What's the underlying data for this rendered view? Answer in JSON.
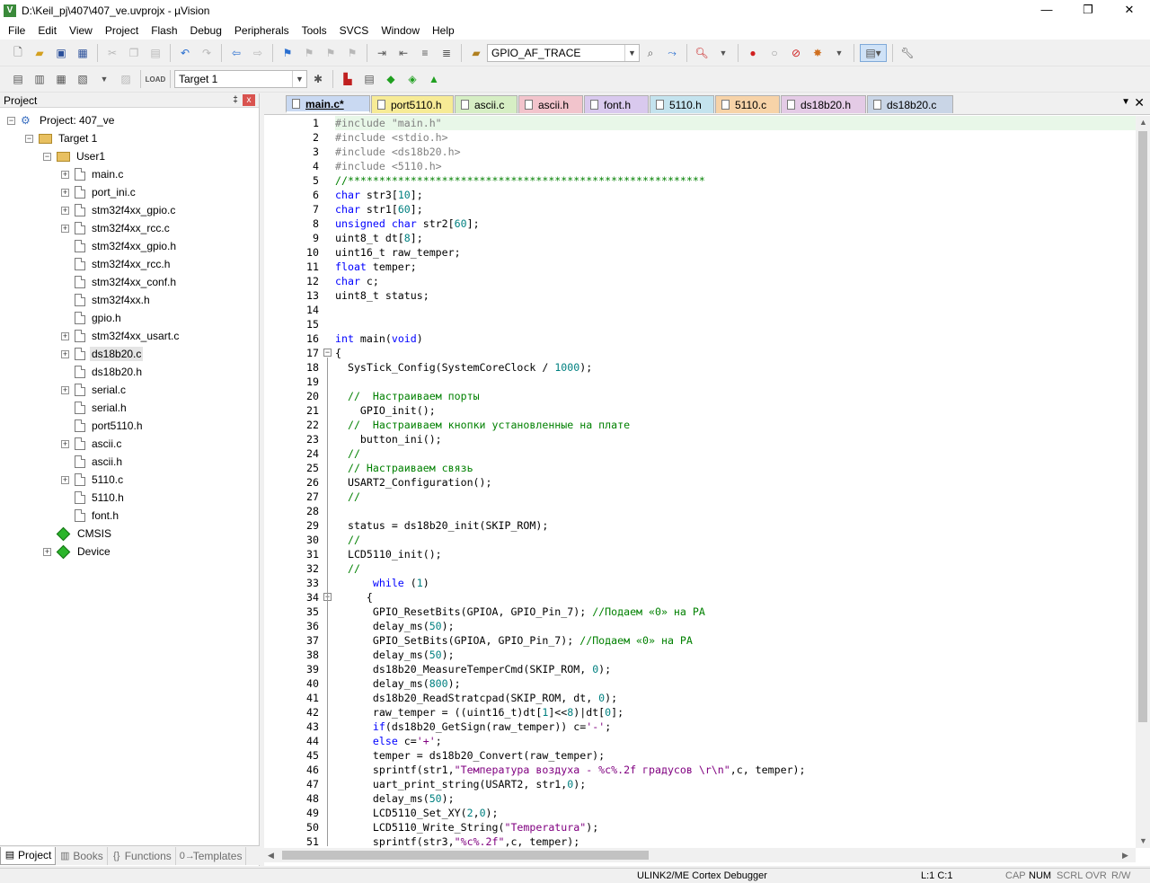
{
  "window": {
    "title": "D:\\Keil_pj\\407\\407_ve.uvprojx - µVision",
    "app_icon": "V",
    "minimize": "—",
    "maximize": "❐",
    "close": "✕"
  },
  "menu": [
    "File",
    "Edit",
    "View",
    "Project",
    "Flash",
    "Debug",
    "Peripherals",
    "Tools",
    "SVCS",
    "Window",
    "Help"
  ],
  "toolbar1": {
    "find_combo_value": "GPIO_AF_TRACE"
  },
  "toolbar2": {
    "target_combo_value": "Target 1"
  },
  "project_panel": {
    "title": "Project",
    "pin": "‡",
    "close": "x",
    "tree": {
      "project": "Project: 407_ve",
      "target": "Target 1",
      "group": "User1",
      "files": [
        {
          "name": "main.c",
          "expandable": true
        },
        {
          "name": "port_ini.c",
          "expandable": true
        },
        {
          "name": "stm32f4xx_gpio.c",
          "expandable": true
        },
        {
          "name": "stm32f4xx_rcc.c",
          "expandable": true
        },
        {
          "name": "stm32f4xx_gpio.h",
          "expandable": false
        },
        {
          "name": "stm32f4xx_rcc.h",
          "expandable": false
        },
        {
          "name": "stm32f4xx_conf.h",
          "expandable": false
        },
        {
          "name": "stm32f4xx.h",
          "expandable": false
        },
        {
          "name": "gpio.h",
          "expandable": false
        },
        {
          "name": "stm32f4xx_usart.c",
          "expandable": true
        },
        {
          "name": "ds18b20.c",
          "expandable": true
        },
        {
          "name": "ds18b20.h",
          "expandable": false
        },
        {
          "name": "serial.c",
          "expandable": true
        },
        {
          "name": "serial.h",
          "expandable": false
        },
        {
          "name": "port5110.h",
          "expandable": false
        },
        {
          "name": "ascii.c",
          "expandable": true
        },
        {
          "name": "ascii.h",
          "expandable": false
        },
        {
          "name": "5110.c",
          "expandable": true
        },
        {
          "name": "5110.h",
          "expandable": false
        },
        {
          "name": "font.h",
          "expandable": false
        }
      ],
      "cmsis": "CMSIS",
      "device": "Device"
    },
    "bottom_tabs": [
      {
        "label": "Project",
        "icon": "▤"
      },
      {
        "label": "Books",
        "icon": "▥"
      },
      {
        "label": "Functions",
        "icon": "{}"
      },
      {
        "label": "Templates",
        "icon": "0→"
      }
    ]
  },
  "editor_tabs": [
    {
      "label": "main.c*",
      "color": "#c9d9f2"
    },
    {
      "label": "port5110.h",
      "color": "#f7eb96"
    },
    {
      "label": "ascii.c",
      "color": "#d6eec4"
    },
    {
      "label": "ascii.h",
      "color": "#f2c4cc"
    },
    {
      "label": "font.h",
      "color": "#d9c9ee"
    },
    {
      "label": "5110.h",
      "color": "#c4e3ee"
    },
    {
      "label": "5110.c",
      "color": "#f7d3a8"
    },
    {
      "label": "ds18b20.h",
      "color": "#e4cbe6"
    },
    {
      "label": "ds18b20.c",
      "color": "#c9d5e6"
    }
  ],
  "code_lines": [
    "#include \"main.h\"",
    "#include <stdio.h>",
    "#include <ds18b20.h>",
    "#include <5110.h>",
    "//*********************************************************",
    "char str3[10];",
    "char str1[60];",
    "unsigned char str2[60];",
    "uint8_t dt[8];",
    "uint16_t raw_temper;",
    "float temper;",
    "char c;",
    "uint8_t status;",
    "",
    "",
    "int main(void)",
    "{",
    "  SysTick_Config(SystemCoreClock / 1000);",
    "",
    "  //  Настраиваем порты",
    "    GPIO_init();",
    "  //  Настраиваем кнопки установленные на плате",
    "    button_ini();",
    "  //",
    "  // Настраиваем связь",
    "  USART2_Configuration();",
    "  //",
    "",
    "  status = ds18b20_init(SKIP_ROM);",
    "  //",
    "  LCD5110_init();",
    "  //",
    "      while (1)",
    "     {",
    "      GPIO_ResetBits(GPIOA, GPIO_Pin_7); //Подаем «0» на PA",
    "      delay_ms(50);",
    "      GPIO_SetBits(GPIOA, GPIO_Pin_7); //Подаем «0» на PA",
    "      delay_ms(50);",
    "      ds18b20_MeasureTemperCmd(SKIP_ROM, 0);",
    "      delay_ms(800);",
    "      ds18b20_ReadStratcpad(SKIP_ROM, dt, 0);",
    "      raw_temper = ((uint16_t)dt[1]<<8)|dt[0];",
    "      if(ds18b20_GetSign(raw_temper)) c='-';",
    "      else c='+';",
    "      temper = ds18b20_Convert(raw_temper);",
    "      sprintf(str1,\"Температура воздуха - %c%.2f градусов \\r\\n\",c, temper);",
    "      uart_print_string(USART2, str1,0);",
    "      delay_ms(50);",
    "      LCD5110_Set_XY(2,0);",
    "      LCD5110_Write_String(\"Temperatura\");",
    "      sprintf(str3,\"%c%.2f\",c, temper);"
  ],
  "fold_markers": {
    "17": "−",
    "34": "−"
  },
  "status": {
    "debugger": "ULINK2/ME Cortex Debugger",
    "position": "L:1 C:1",
    "cap": "CAP",
    "num": "NUM",
    "scrl": "SCRL",
    "ovr": "OVR",
    "rw": "R/W"
  },
  "colors": {
    "keyword": "#0000ff",
    "comment": "#008000",
    "string": "#800080",
    "number": "#008080",
    "preprocessor": "#808080",
    "current_line": "#e8f7e8"
  }
}
